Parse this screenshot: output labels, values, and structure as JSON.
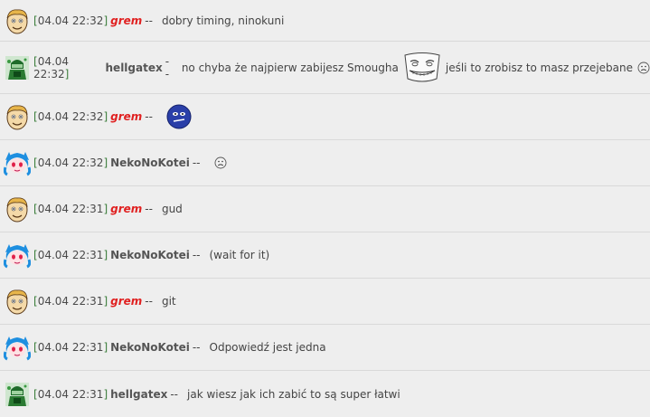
{
  "messages": [
    {
      "time": "04.04 22:32",
      "nick": "grem",
      "text": "dobry timing, ninokuni"
    },
    {
      "time": "04.04 22:32",
      "nick": "hellgatex",
      "text_before": "no chyba że najpierw zabijesz Smougha",
      "emoticon": "troll-face-icon",
      "text_after": "jeśli to zrobisz to masz przejebane",
      "trailing_emoticon": "sad-face-icon"
    },
    {
      "time": "04.04 22:32",
      "nick": "grem",
      "emoticon": "blue-ball-emoticon-icon"
    },
    {
      "time": "04.04 22:32",
      "nick": "NekoNoKotei",
      "emoticon": "sad-face-icon"
    },
    {
      "time": "04.04 22:31",
      "nick": "grem",
      "text": "gud"
    },
    {
      "time": "04.04 22:31",
      "nick": "NekoNoKotei",
      "text": "(wait for it)"
    },
    {
      "time": "04.04 22:31",
      "nick": "grem",
      "text": "git"
    },
    {
      "time": "04.04 22:31",
      "nick": "NekoNoKotei",
      "text": "Odpowiedź jest jedna"
    },
    {
      "time": "04.04 22:31",
      "nick": "hellgatex",
      "text": "jak wiesz jak ich zabić to są super łatwi"
    }
  ],
  "separator": "--",
  "colors": {
    "grem": "#e02020",
    "nick": "#555555",
    "timestamp_bracket": "#3a7d3a",
    "background": "#eeeeee"
  }
}
